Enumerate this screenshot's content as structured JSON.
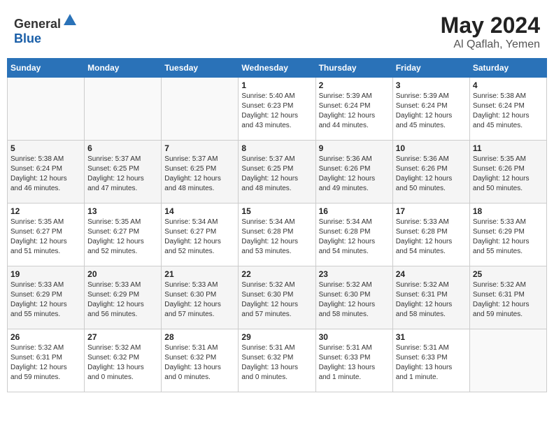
{
  "header": {
    "logo_general": "General",
    "logo_blue": "Blue",
    "month_year": "May 2024",
    "location": "Al Qaflah, Yemen"
  },
  "calendar": {
    "days_of_week": [
      "Sunday",
      "Monday",
      "Tuesday",
      "Wednesday",
      "Thursday",
      "Friday",
      "Saturday"
    ],
    "weeks": [
      [
        {
          "day": "",
          "info": ""
        },
        {
          "day": "",
          "info": ""
        },
        {
          "day": "",
          "info": ""
        },
        {
          "day": "1",
          "info": "Sunrise: 5:40 AM\nSunset: 6:23 PM\nDaylight: 12 hours\nand 43 minutes."
        },
        {
          "day": "2",
          "info": "Sunrise: 5:39 AM\nSunset: 6:24 PM\nDaylight: 12 hours\nand 44 minutes."
        },
        {
          "day": "3",
          "info": "Sunrise: 5:39 AM\nSunset: 6:24 PM\nDaylight: 12 hours\nand 45 minutes."
        },
        {
          "day": "4",
          "info": "Sunrise: 5:38 AM\nSunset: 6:24 PM\nDaylight: 12 hours\nand 45 minutes."
        }
      ],
      [
        {
          "day": "5",
          "info": "Sunrise: 5:38 AM\nSunset: 6:24 PM\nDaylight: 12 hours\nand 46 minutes."
        },
        {
          "day": "6",
          "info": "Sunrise: 5:37 AM\nSunset: 6:25 PM\nDaylight: 12 hours\nand 47 minutes."
        },
        {
          "day": "7",
          "info": "Sunrise: 5:37 AM\nSunset: 6:25 PM\nDaylight: 12 hours\nand 48 minutes."
        },
        {
          "day": "8",
          "info": "Sunrise: 5:37 AM\nSunset: 6:25 PM\nDaylight: 12 hours\nand 48 minutes."
        },
        {
          "day": "9",
          "info": "Sunrise: 5:36 AM\nSunset: 6:26 PM\nDaylight: 12 hours\nand 49 minutes."
        },
        {
          "day": "10",
          "info": "Sunrise: 5:36 AM\nSunset: 6:26 PM\nDaylight: 12 hours\nand 50 minutes."
        },
        {
          "day": "11",
          "info": "Sunrise: 5:35 AM\nSunset: 6:26 PM\nDaylight: 12 hours\nand 50 minutes."
        }
      ],
      [
        {
          "day": "12",
          "info": "Sunrise: 5:35 AM\nSunset: 6:27 PM\nDaylight: 12 hours\nand 51 minutes."
        },
        {
          "day": "13",
          "info": "Sunrise: 5:35 AM\nSunset: 6:27 PM\nDaylight: 12 hours\nand 52 minutes."
        },
        {
          "day": "14",
          "info": "Sunrise: 5:34 AM\nSunset: 6:27 PM\nDaylight: 12 hours\nand 52 minutes."
        },
        {
          "day": "15",
          "info": "Sunrise: 5:34 AM\nSunset: 6:28 PM\nDaylight: 12 hours\nand 53 minutes."
        },
        {
          "day": "16",
          "info": "Sunrise: 5:34 AM\nSunset: 6:28 PM\nDaylight: 12 hours\nand 54 minutes."
        },
        {
          "day": "17",
          "info": "Sunrise: 5:33 AM\nSunset: 6:28 PM\nDaylight: 12 hours\nand 54 minutes."
        },
        {
          "day": "18",
          "info": "Sunrise: 5:33 AM\nSunset: 6:29 PM\nDaylight: 12 hours\nand 55 minutes."
        }
      ],
      [
        {
          "day": "19",
          "info": "Sunrise: 5:33 AM\nSunset: 6:29 PM\nDaylight: 12 hours\nand 55 minutes."
        },
        {
          "day": "20",
          "info": "Sunrise: 5:33 AM\nSunset: 6:29 PM\nDaylight: 12 hours\nand 56 minutes."
        },
        {
          "day": "21",
          "info": "Sunrise: 5:33 AM\nSunset: 6:30 PM\nDaylight: 12 hours\nand 57 minutes."
        },
        {
          "day": "22",
          "info": "Sunrise: 5:32 AM\nSunset: 6:30 PM\nDaylight: 12 hours\nand 57 minutes."
        },
        {
          "day": "23",
          "info": "Sunrise: 5:32 AM\nSunset: 6:30 PM\nDaylight: 12 hours\nand 58 minutes."
        },
        {
          "day": "24",
          "info": "Sunrise: 5:32 AM\nSunset: 6:31 PM\nDaylight: 12 hours\nand 58 minutes."
        },
        {
          "day": "25",
          "info": "Sunrise: 5:32 AM\nSunset: 6:31 PM\nDaylight: 12 hours\nand 59 minutes."
        }
      ],
      [
        {
          "day": "26",
          "info": "Sunrise: 5:32 AM\nSunset: 6:31 PM\nDaylight: 12 hours\nand 59 minutes."
        },
        {
          "day": "27",
          "info": "Sunrise: 5:32 AM\nSunset: 6:32 PM\nDaylight: 13 hours\nand 0 minutes."
        },
        {
          "day": "28",
          "info": "Sunrise: 5:31 AM\nSunset: 6:32 PM\nDaylight: 13 hours\nand 0 minutes."
        },
        {
          "day": "29",
          "info": "Sunrise: 5:31 AM\nSunset: 6:32 PM\nDaylight: 13 hours\nand 0 minutes."
        },
        {
          "day": "30",
          "info": "Sunrise: 5:31 AM\nSunset: 6:33 PM\nDaylight: 13 hours\nand 1 minute."
        },
        {
          "day": "31",
          "info": "Sunrise: 5:31 AM\nSunset: 6:33 PM\nDaylight: 13 hours\nand 1 minute."
        },
        {
          "day": "",
          "info": ""
        }
      ]
    ]
  }
}
